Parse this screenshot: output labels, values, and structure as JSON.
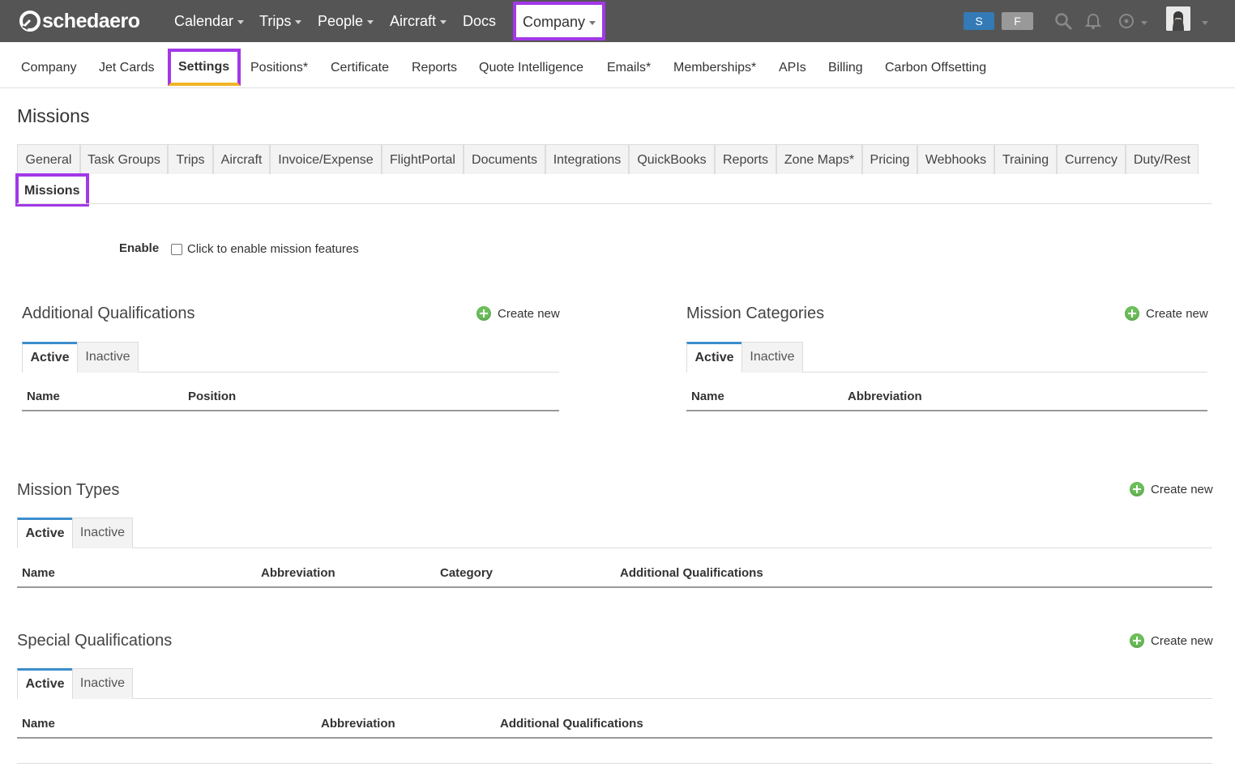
{
  "app": {
    "logo_text": "schedaero"
  },
  "topnav": {
    "calendar": "Calendar",
    "trips": "Trips",
    "people": "People",
    "aircraft": "Aircraft",
    "docs": "Docs",
    "company": "Company",
    "badge_s": "S",
    "badge_f": "F"
  },
  "subnav": {
    "items": [
      "Company",
      "Jet Cards",
      "Settings",
      "Positions*",
      "Certificate",
      "Reports",
      "Quote Intelligence",
      "Emails*",
      "Memberships*",
      "APIs",
      "Billing",
      "Carbon Offsetting"
    ]
  },
  "page": {
    "title": "Missions"
  },
  "settings_tabs": [
    "General",
    "Task Groups",
    "Trips",
    "Aircraft",
    "Invoice/Expense",
    "FlightPortal",
    "Documents",
    "Integrations",
    "QuickBooks",
    "Reports",
    "Zone Maps*",
    "Pricing",
    "Webhooks",
    "Training",
    "Currency",
    "Duty/Rest",
    "Missions"
  ],
  "enable": {
    "label": "Enable",
    "checkbox_text": "Click to enable mission features",
    "checked": false
  },
  "common": {
    "create_new": "Create new",
    "active": "Active",
    "inactive": "Inactive"
  },
  "sections": {
    "additional_qualifications": {
      "title": "Additional Qualifications",
      "columns": [
        "Name",
        "Position"
      ]
    },
    "mission_categories": {
      "title": "Mission Categories",
      "columns": [
        "Name",
        "Abbreviation"
      ]
    },
    "mission_types": {
      "title": "Mission Types",
      "columns": [
        "Name",
        "Abbreviation",
        "Category",
        "Additional Qualifications"
      ]
    },
    "special_qualifications": {
      "title": "Special Qualifications",
      "columns": [
        "Name",
        "Abbreviation",
        "Additional Qualifications"
      ]
    }
  },
  "colors": {
    "navbar": "#555555",
    "highlight": "#a238e8",
    "tab_active_border": "#3c8dcc",
    "create_icon": "#6cbf5a"
  }
}
